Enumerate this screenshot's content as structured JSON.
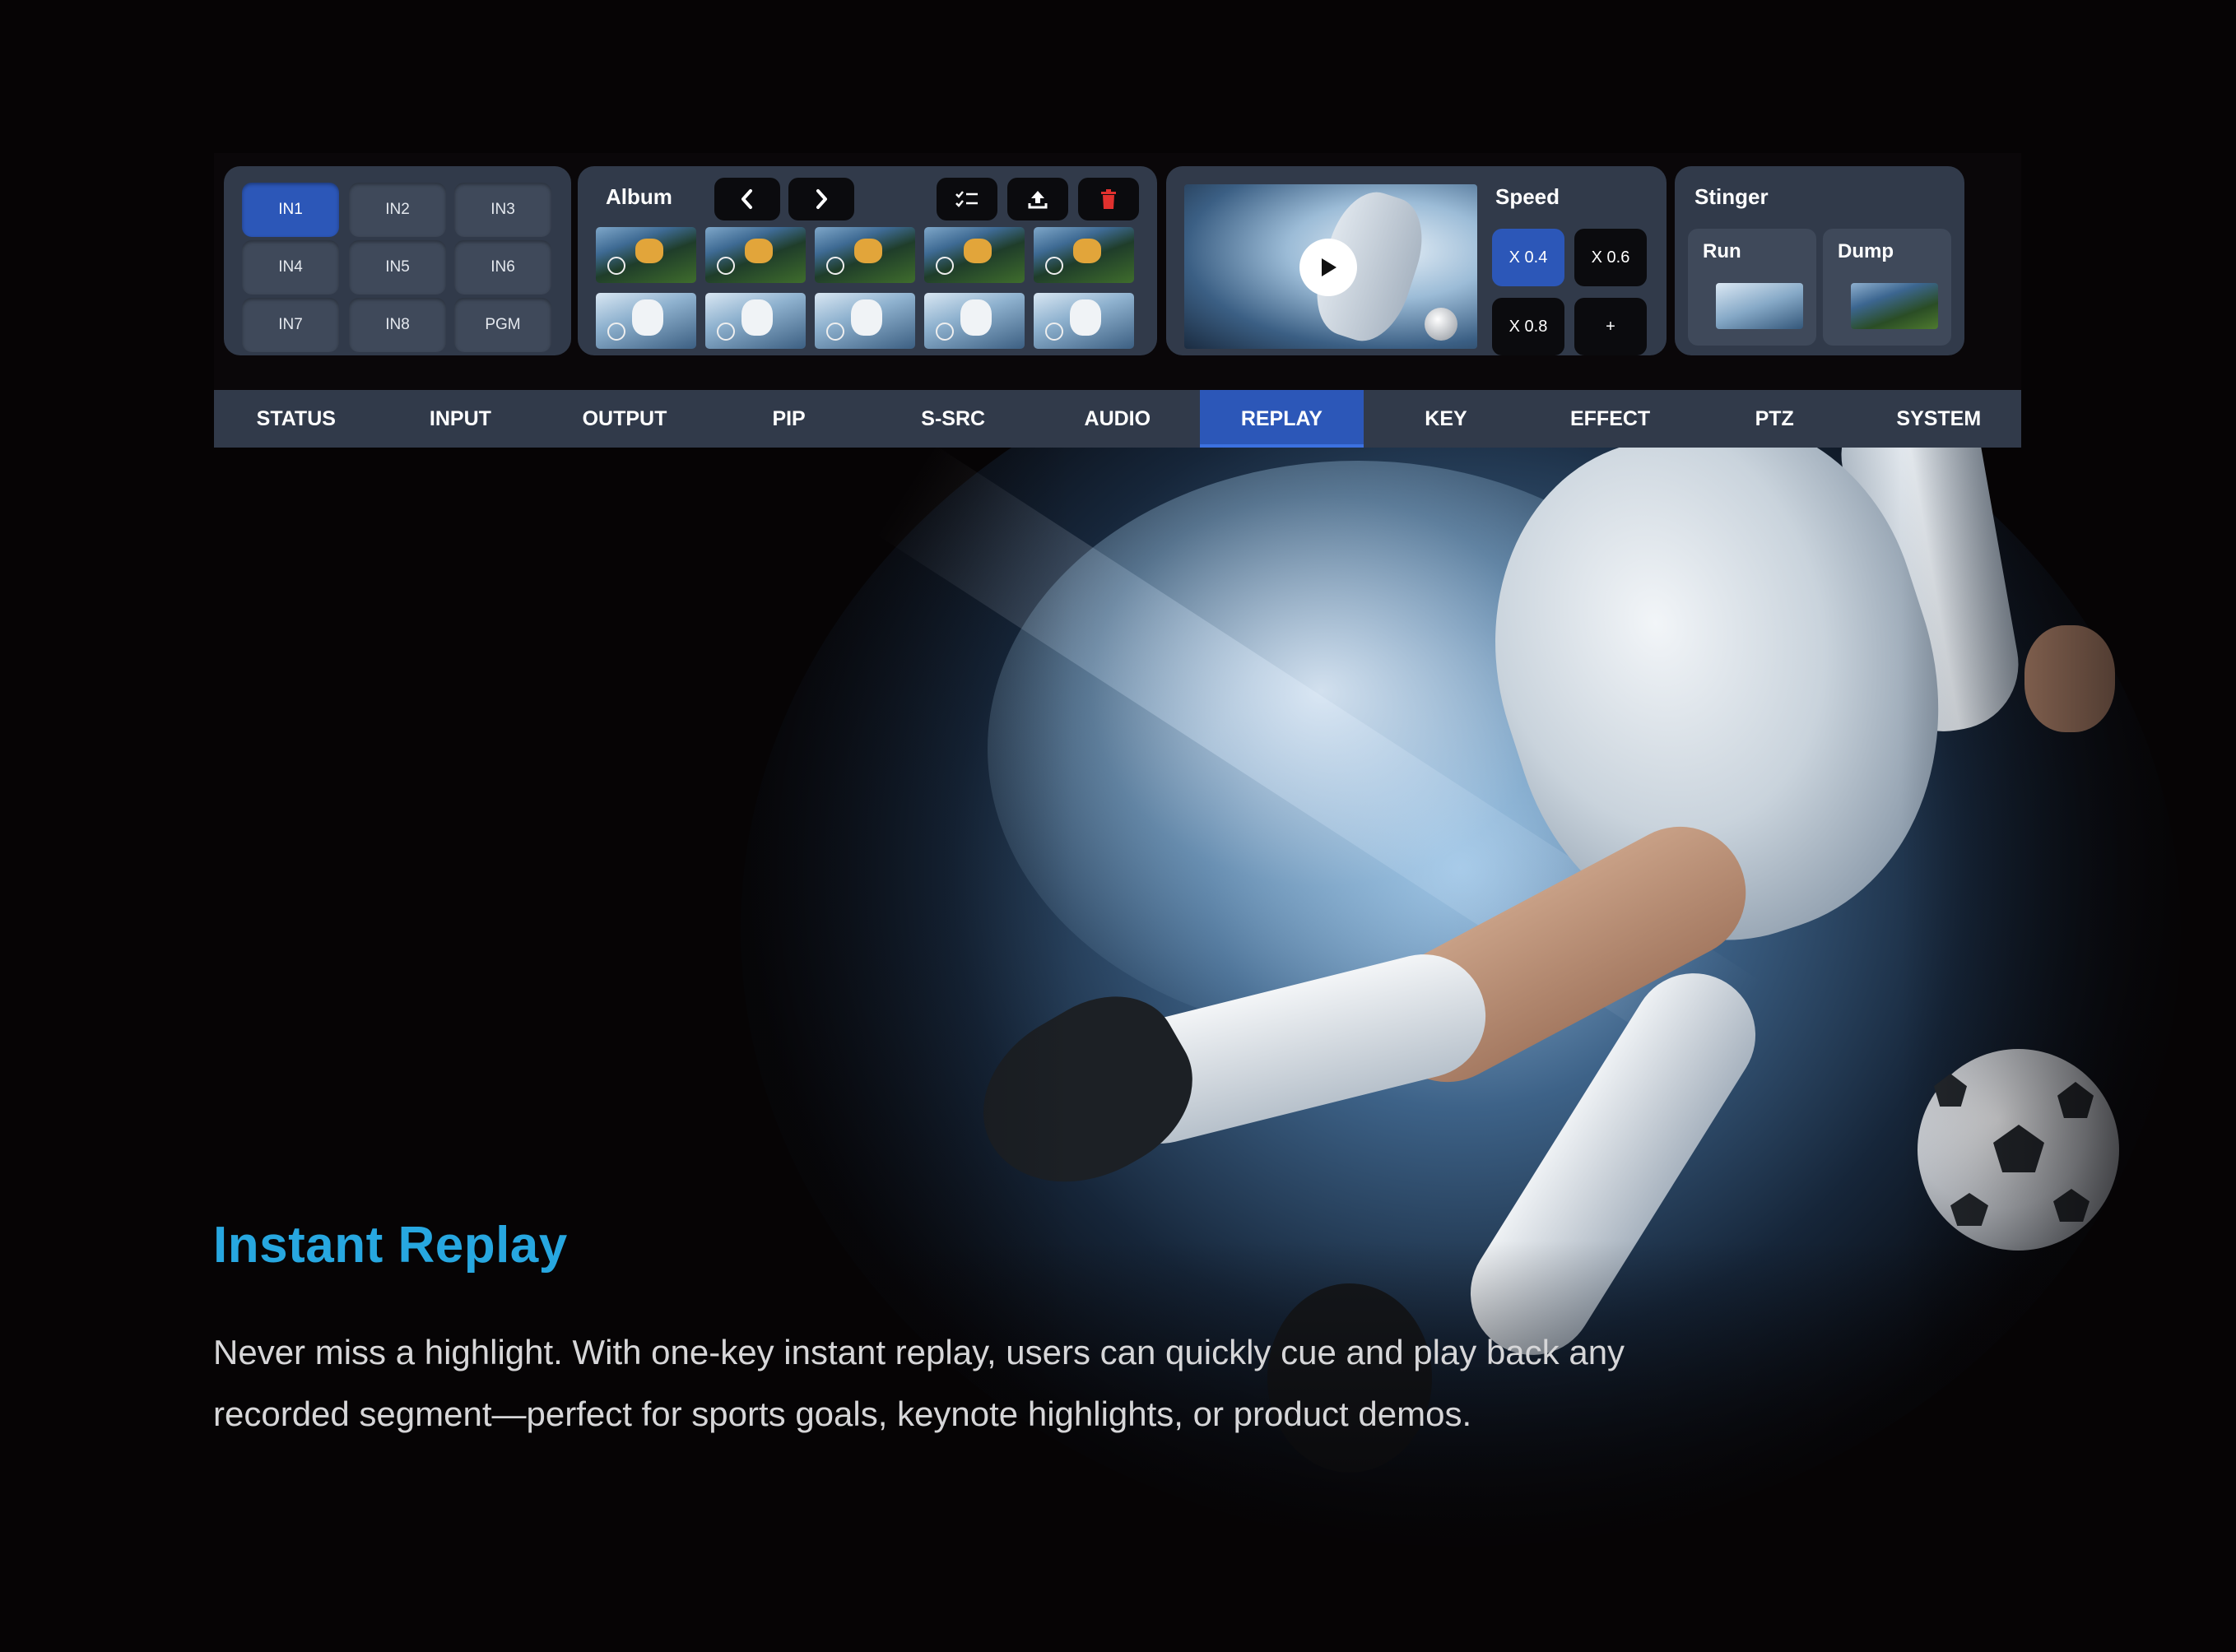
{
  "colors": {
    "accent": "#2c57b8",
    "panel": "#313a4a",
    "headline": "#27a7e0",
    "background": "#060405"
  },
  "inputs": {
    "buttons": [
      "IN1",
      "IN2",
      "IN3",
      "IN4",
      "IN5",
      "IN6",
      "IN7",
      "IN8",
      "PGM"
    ],
    "selected": "IN1"
  },
  "album": {
    "title": "Album",
    "icons": [
      "chevron-left-icon",
      "chevron-right-icon",
      "checklist-icon",
      "upload-icon",
      "trash-icon"
    ]
  },
  "speed": {
    "title": "Speed",
    "options": [
      "X 0.4",
      "X 0.6",
      "X 0.8",
      "+"
    ],
    "selected": "X 0.4"
  },
  "stinger": {
    "title": "Stinger",
    "run_label": "Run",
    "dump_label": "Dump"
  },
  "tabs": {
    "items": [
      "STATUS",
      "INPUT",
      "OUTPUT",
      "PIP",
      "S-SRC",
      "AUDIO",
      "REPLAY",
      "KEY",
      "EFFECT",
      "PTZ",
      "SYSTEM"
    ],
    "active": "REPLAY"
  },
  "content": {
    "headline": "Instant Replay",
    "body": "Never miss a highlight. With one-key instant replay, users can quickly cue and play back any recorded segment—perfect for sports goals, keynote highlights, or product demos."
  }
}
